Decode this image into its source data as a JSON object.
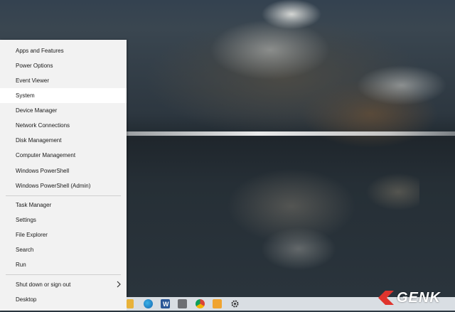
{
  "context_menu": {
    "items": [
      {
        "label": "Apps and Features"
      },
      {
        "label": "Power Options"
      },
      {
        "label": "Event Viewer"
      },
      {
        "label": "System"
      },
      {
        "label": "Device Manager"
      },
      {
        "label": "Network Connections"
      },
      {
        "label": "Disk Management"
      },
      {
        "label": "Computer Management"
      },
      {
        "label": "Windows PowerShell"
      },
      {
        "label": "Windows PowerShell (Admin)"
      },
      {
        "label": "Task Manager"
      },
      {
        "label": "Settings"
      },
      {
        "label": "File Explorer"
      },
      {
        "label": "Search"
      },
      {
        "label": "Run"
      },
      {
        "label": "Shut down or sign out",
        "submenu_icon": "chevron-right-icon"
      },
      {
        "label": "Desktop"
      }
    ],
    "highlighted": "System"
  },
  "taskbar": {
    "icons": [
      "folder-icon",
      "edge-icon",
      "word-icon",
      "app-icon",
      "chrome-icon",
      "photos-icon",
      "gear-icon"
    ]
  },
  "watermark": {
    "text": "GENK"
  },
  "colors": {
    "menu_bg": "#f2f2f2",
    "highlight": "#ffffff",
    "taskbar_bg": "#d9dee3",
    "watermark_red": "#e0342d"
  }
}
